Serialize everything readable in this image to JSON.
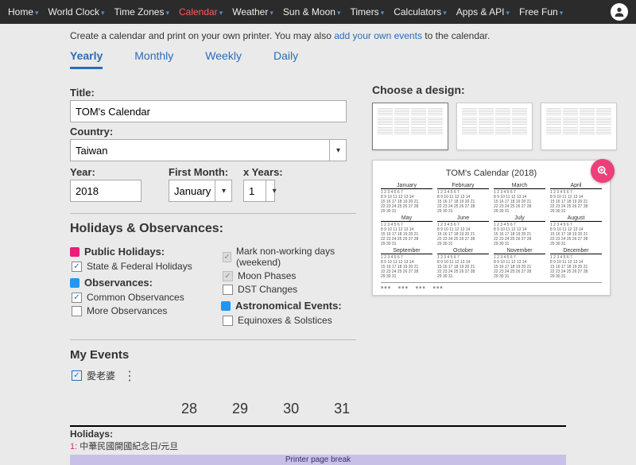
{
  "nav": {
    "items": [
      "Home",
      "World Clock",
      "Time Zones",
      "Calendar",
      "Weather",
      "Sun & Moon",
      "Timers",
      "Calculators",
      "Apps & API",
      "Free Fun"
    ],
    "activeIndex": 3
  },
  "intro": {
    "pre": "Create a calendar and print on your own printer. You may also ",
    "link": "add your own events",
    "post": " to the calendar."
  },
  "tabs": {
    "items": [
      "Yearly",
      "Monthly",
      "Weekly",
      "Daily"
    ],
    "activeIndex": 0
  },
  "form": {
    "titleLabel": "Title:",
    "titleValue": "TOM's Calendar",
    "countryLabel": "Country:",
    "countryValue": "Taiwan",
    "yearLabel": "Year:",
    "yearValue": "2018",
    "firstMonthLabel": "First Month:",
    "firstMonthValue": "January",
    "xYearsLabel": "x Years:",
    "xYearsValue": "1"
  },
  "holidays": {
    "sectionTitle": "Holidays & Observances:",
    "publicHead": "Public Holidays:",
    "stateFederal": "State & Federal Holidays",
    "obsHead": "Observances:",
    "commonObs": "Common Observances",
    "moreObs": "More Observances",
    "markWeekend": "Mark non-working days (weekend)",
    "moonPhases": "Moon Phases",
    "dstChanges": "DST Changes",
    "astroHead": "Astronomical Events:",
    "eqSol": "Equinoxes & Solstices"
  },
  "myEvents": {
    "head": "My Events",
    "item1": "愛老婆"
  },
  "design": {
    "head": "Choose a design:",
    "previewTitle": "TOM's Calendar (2018)",
    "months": [
      "January",
      "February",
      "March",
      "April",
      "May",
      "June",
      "July",
      "August",
      "September",
      "October",
      "November",
      "December"
    ]
  },
  "bottom": {
    "weeks": [
      "28",
      "29",
      "30",
      "31"
    ],
    "holHead": "Holidays:",
    "hol1num": "1:",
    "hol1text": " 中華民國開國紀念日/元旦",
    "pager": "Printer page break"
  }
}
